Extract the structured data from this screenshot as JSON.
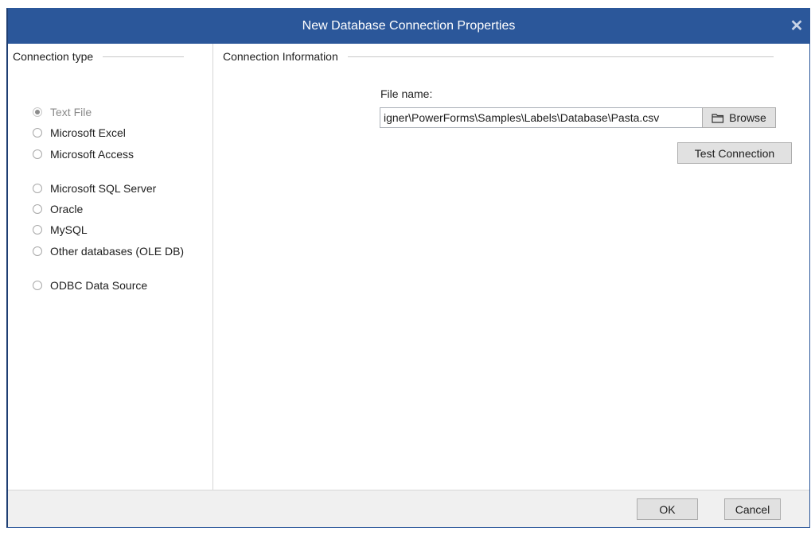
{
  "window": {
    "title": "New Database Connection Properties",
    "close_icon": "✕"
  },
  "left": {
    "header": "Connection type",
    "options": [
      {
        "label": "Text File",
        "checked": true,
        "disabled": true
      },
      {
        "label": "Microsoft Excel",
        "checked": false
      },
      {
        "label": "Microsoft Access",
        "checked": false
      },
      {
        "label": "Microsoft SQL Server",
        "checked": false
      },
      {
        "label": "Oracle",
        "checked": false
      },
      {
        "label": "MySQL",
        "checked": false
      },
      {
        "label": "Other databases (OLE DB)",
        "checked": false
      },
      {
        "label": "ODBC Data Source",
        "checked": false
      }
    ]
  },
  "right": {
    "header": "Connection Information",
    "file_label": "File name:",
    "file_value": "igner\\PowerForms\\Samples\\Labels\\Database\\Pasta.csv",
    "browse_label": "Browse",
    "browse_icon": "folder-icon",
    "test_label": "Test Connection"
  },
  "footer": {
    "ok_label": "OK",
    "cancel_label": "Cancel"
  },
  "colors": {
    "titlebar": "#2b579a",
    "footer": "#f0f0f0"
  }
}
